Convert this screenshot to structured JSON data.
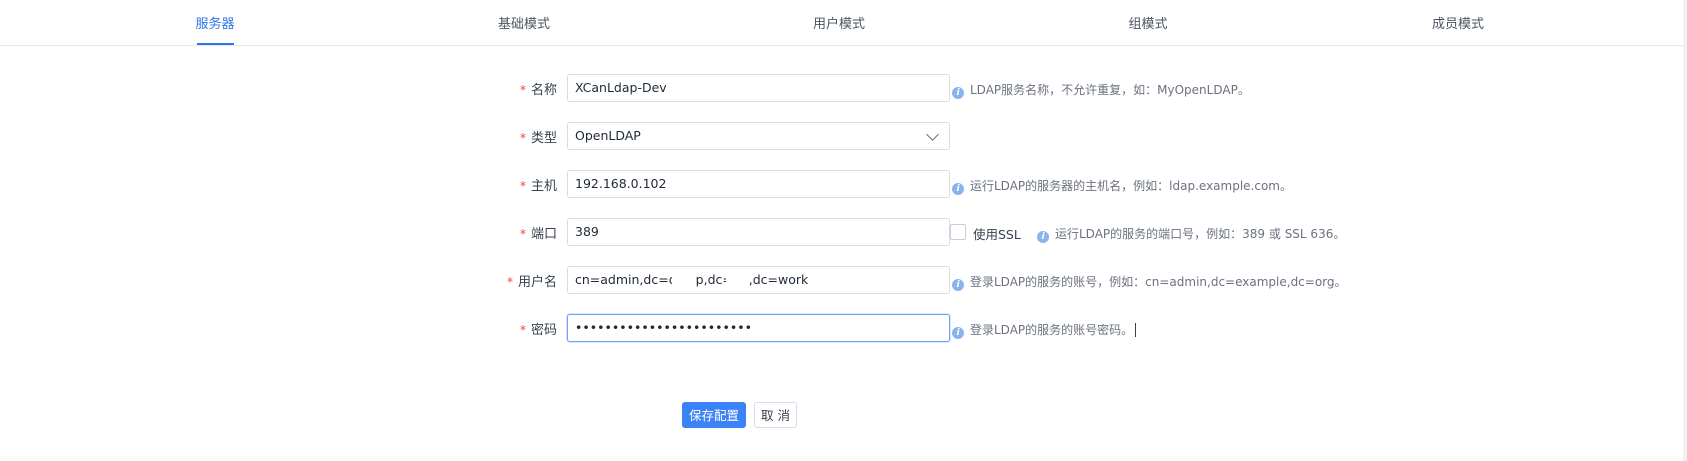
{
  "tabs": [
    {
      "label": "服务器",
      "active": true
    },
    {
      "label": "基础模式",
      "active": false
    },
    {
      "label": "用户模式",
      "active": false
    },
    {
      "label": "组模式",
      "active": false
    },
    {
      "label": "成员模式",
      "active": false
    }
  ],
  "form": {
    "required_mark": "*",
    "name": {
      "label": "名称",
      "value": "XCanLdap-Dev",
      "hint": "LDAP服务名称，不允许重复，如：MyOpenLDAP。"
    },
    "type": {
      "label": "类型",
      "value": "OpenLDAP"
    },
    "host": {
      "label": "主机",
      "value": "192.168.0.102",
      "hint": "运行LDAP的服务器的主机名，例如：ldap.example.com。"
    },
    "port": {
      "label": "端口",
      "value": "389",
      "ssl_label": "使用SSL",
      "ssl_checked": false,
      "hint": "运行LDAP的服务的端口号，例如：389 或 SSL 636。"
    },
    "username": {
      "label": "用户名",
      "value": "cn=admin,dc=dev        p,dc=.     ..,dc=work",
      "hint": "登录LDAP的服务的账号，例如：cn=admin,dc=example,dc=org。"
    },
    "password": {
      "label": "密码",
      "value": "••••••••••••••••••••••••",
      "hint": "登录LDAP的服务的账号密码。"
    }
  },
  "actions": {
    "save_label": "保存配置",
    "cancel_label": "取 消"
  },
  "colors": {
    "accent": "#2f74e8",
    "required": "#ef4444",
    "primary_button": "#3b82f6"
  }
}
